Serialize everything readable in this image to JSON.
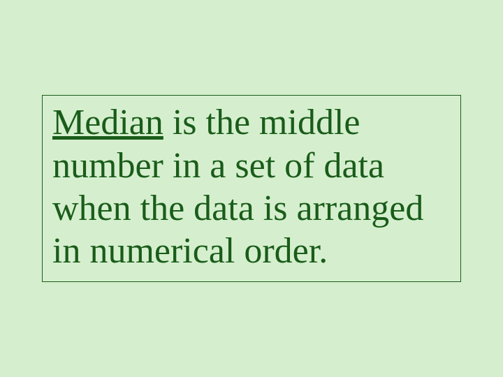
{
  "definition": {
    "term": "Median",
    "body": " is the middle number in a set of data when the data is arranged in numerical order."
  }
}
